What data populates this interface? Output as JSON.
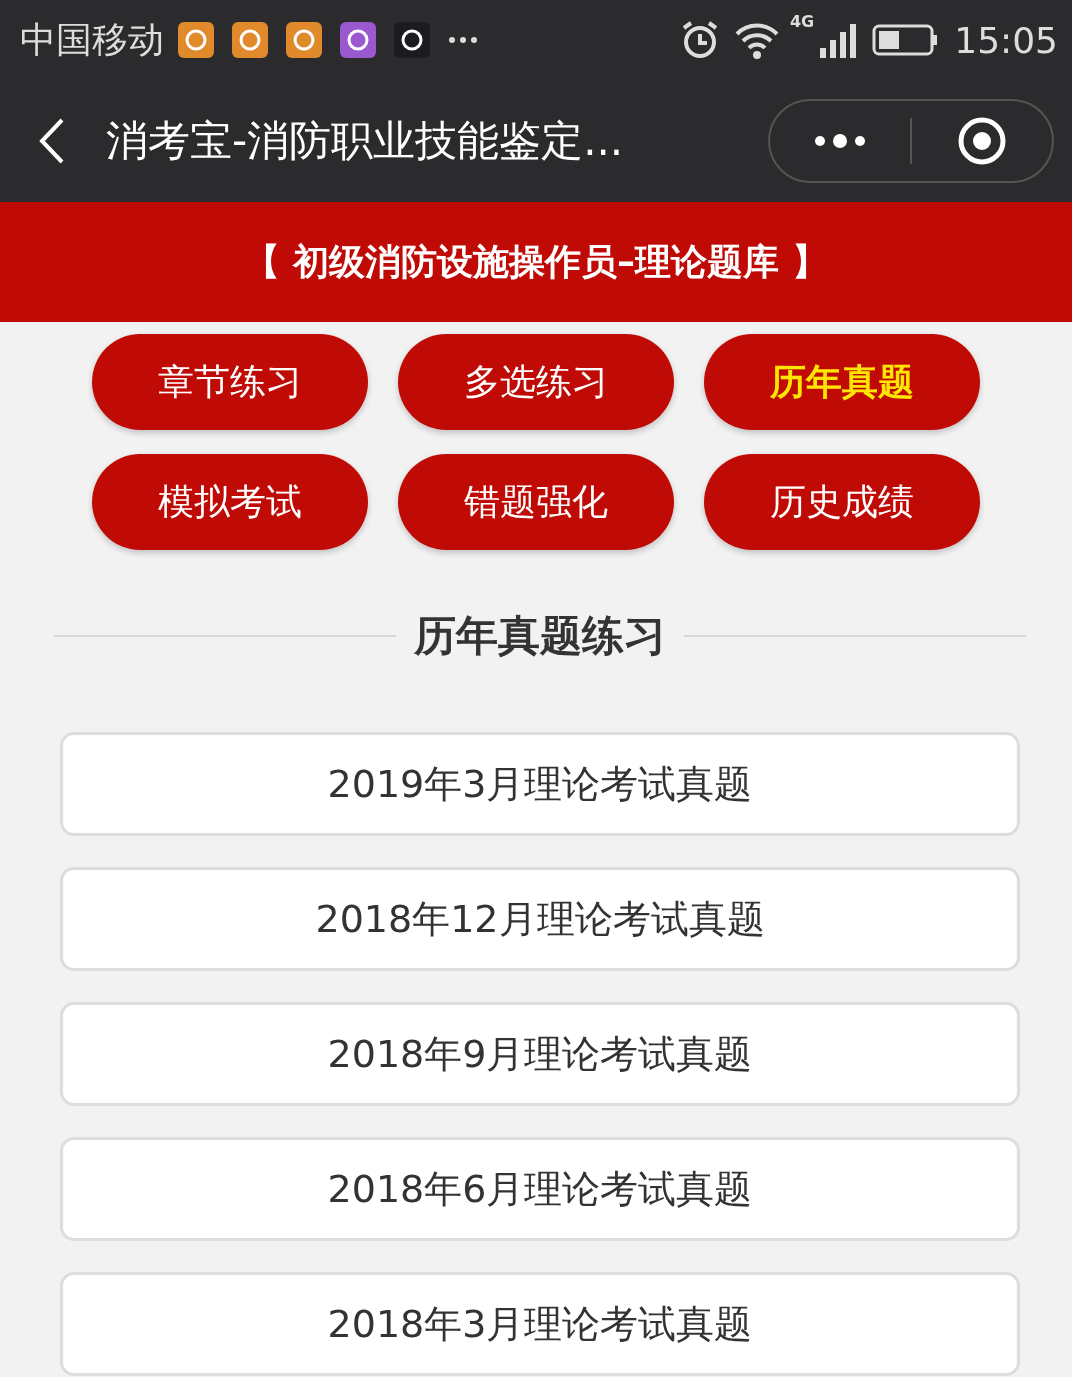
{
  "status_bar": {
    "carrier": "中国移动",
    "network": "4G",
    "time": "15:05"
  },
  "nav": {
    "title": "消考宝-消防职业技能鉴定..."
  },
  "banner": {
    "title": "【 初级消防设施操作员–理论题库 】"
  },
  "menu": [
    {
      "label": "章节练习",
      "selected": false
    },
    {
      "label": "多选练习",
      "selected": false
    },
    {
      "label": "历年真题",
      "selected": true
    },
    {
      "label": "模拟考试",
      "selected": false
    },
    {
      "label": "错题强化",
      "selected": false
    },
    {
      "label": "历史成绩",
      "selected": false
    }
  ],
  "section": {
    "title": "历年真题练习"
  },
  "exams": [
    {
      "label": "2019年3月理论考试真题"
    },
    {
      "label": "2018年12月理论考试真题"
    },
    {
      "label": "2018年9月理论考试真题"
    },
    {
      "label": "2018年6月理论考试真题"
    },
    {
      "label": "2018年3月理论考试真题"
    }
  ]
}
